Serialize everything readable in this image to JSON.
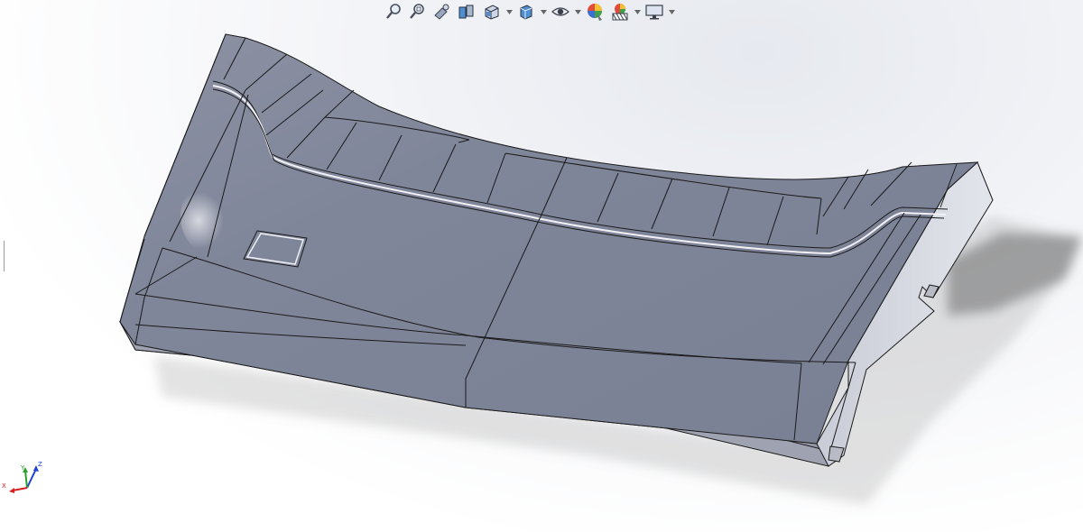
{
  "toolbar": {
    "items": [
      {
        "name": "zoom-to-fit-icon",
        "has_menu": false
      },
      {
        "name": "zoom-to-area-icon",
        "has_menu": false
      },
      {
        "name": "previous-view-icon",
        "has_menu": false
      },
      {
        "name": "section-view-icon",
        "has_menu": false
      },
      {
        "name": "view-orientation-icon",
        "has_menu": true
      },
      {
        "name": "display-style-icon",
        "has_menu": true
      },
      {
        "name": "hide-show-items-icon",
        "has_menu": true
      },
      {
        "name": "edit-appearance-icon",
        "has_menu": false
      },
      {
        "name": "apply-scene-icon",
        "has_menu": true
      },
      {
        "name": "view-settings-icon",
        "has_menu": true
      }
    ]
  },
  "triad": {
    "x_label": "X",
    "y_label": "Y",
    "z_label": "Z",
    "colors": {
      "x": "#d62020",
      "y": "#2aa02a",
      "z": "#2040d0"
    }
  },
  "model": {
    "face_color": "#858b9e",
    "side_color": "#a3a7b4",
    "edge_color": "#1a1a1a"
  }
}
